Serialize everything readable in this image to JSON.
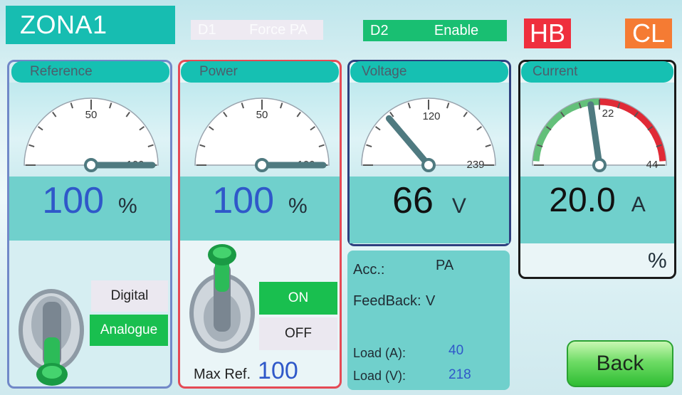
{
  "header": {
    "title": "ZONA1",
    "d1": {
      "tag": "D1",
      "text": "Force PA"
    },
    "d2": {
      "tag": "D2",
      "text": "Enable"
    },
    "hb": "HB",
    "cl": "CL"
  },
  "panels": {
    "reference": {
      "title": "Reference",
      "scale": {
        "mid": "50",
        "max": "100"
      },
      "value": "100",
      "unit": "%",
      "needle_value": 100,
      "switch": {
        "digital": "Digital",
        "analogue": "Analogue"
      }
    },
    "power": {
      "title": "Power",
      "scale": {
        "mid": "50",
        "max": "100"
      },
      "value": "100",
      "unit": "%",
      "needle_value": 100,
      "switch": {
        "on": "ON",
        "off": "OFF"
      },
      "max_ref_label": "Max Ref.",
      "max_ref_value": "100"
    },
    "voltage": {
      "title": "Voltage",
      "scale": {
        "mid": "120",
        "max": "239"
      },
      "value": "66",
      "unit": "V",
      "needle_value": 66
    },
    "current": {
      "title": "Current",
      "scale": {
        "mid": "22",
        "max": "44"
      },
      "value": "20.0",
      "unit": "A",
      "percent_symbol": "%",
      "needle_value": 20
    }
  },
  "info": {
    "acc_label": "Acc.:",
    "acc_value": "PA",
    "feedback_label": "FeedBack:",
    "feedback_value": "V",
    "load_a_label": "Load (A):",
    "load_a_value": "40",
    "load_v_label": "Load (V):",
    "load_v_value": "218"
  },
  "back_label": "Back",
  "colors": {
    "teal": "#16c0b2",
    "reference_border": "#7188c8",
    "power_border": "#e54a55",
    "voltage_border": "#2d3f7e",
    "current_border": "#1a1a1a",
    "value_blue": "#2f58c9",
    "green": "#19bf72"
  }
}
